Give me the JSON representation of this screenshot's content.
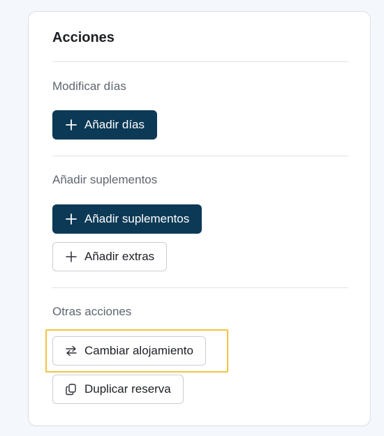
{
  "card": {
    "title": "Acciones"
  },
  "sections": [
    {
      "label": "Modificar días",
      "buttons": [
        {
          "label": "Añadir días",
          "icon": "plus-icon",
          "style": "primary"
        }
      ]
    },
    {
      "label": "Añadir suplementos",
      "buttons": [
        {
          "label": "Añadir suplementos",
          "icon": "plus-icon",
          "style": "primary"
        },
        {
          "label": "Añadir extras",
          "icon": "plus-icon",
          "style": "outline"
        }
      ]
    },
    {
      "label": "Otras acciones",
      "buttons": [
        {
          "label": "Cambiar alojamiento",
          "icon": "swap-arrows-icon",
          "style": "outline",
          "focused": true
        },
        {
          "label": "Duplicar reserva",
          "icon": "copy-icon",
          "style": "outline"
        }
      ]
    }
  ],
  "colors": {
    "primary": "#0c3a56",
    "focus": "#f4c33f",
    "background": "#f4f8fc"
  }
}
